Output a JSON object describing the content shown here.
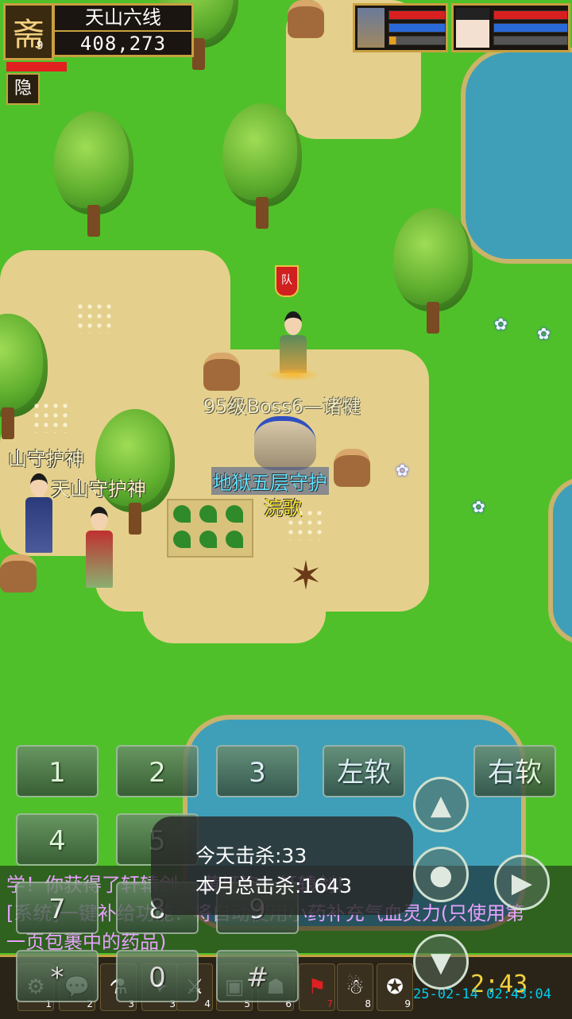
{
  "hud": {
    "portrait_glyph": "斋",
    "level": "9",
    "server_name": "天山六线",
    "money": "408,273",
    "hide_label": "隐"
  },
  "world": {
    "player_name": "95级Boss6—诸犍",
    "player_guild_badge": "队",
    "mount_label": "地狱五层守护",
    "mount_owner": "浣歌",
    "npc_name_1": "山守护神",
    "npc_name_2": "天山守护神"
  },
  "keypad": {
    "keys": [
      "1",
      "2",
      "3",
      "4",
      "5",
      "7",
      "8",
      "9",
      "*",
      "0",
      "#"
    ],
    "left_soft": "左软",
    "right_soft": "右软"
  },
  "chat": {
    "line1": "学！你获得了轩辕剑... 黄轩袍，轩辕剑！",
    "line2": "[系统]一键补给功能：将自动使用小药补充气血灵力(只使用第",
    "line3": "一页包裹中的药品)"
  },
  "toast": {
    "today_kills": "今天击杀:33",
    "month_kills": "本月总击杀:1643"
  },
  "status": {
    "clock": "2:43",
    "timestamp": "25-02-14 02:43:04"
  },
  "colors": {
    "grass": "#4fc02a",
    "dirt": "#e4d08c",
    "water": "#3f9fb8",
    "gold_border": "#c8a040",
    "chat_system": "#e8a0ff"
  }
}
